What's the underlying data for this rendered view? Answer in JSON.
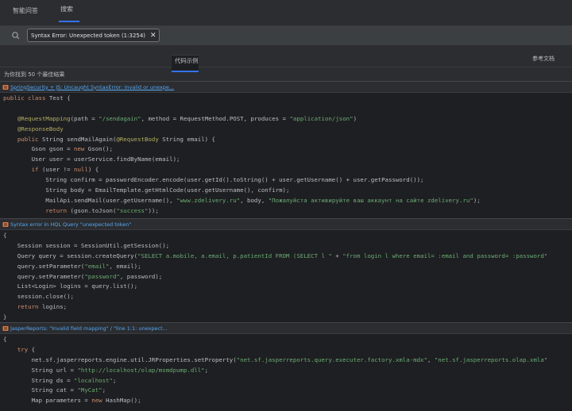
{
  "tabs": [
    {
      "label": "智能问答",
      "active": false
    },
    {
      "label": "搜索",
      "active": true
    }
  ],
  "search": {
    "query": "Syntax Error: Unexpected token (1:3254)",
    "close_glyph": "✕"
  },
  "subtabs": {
    "code_examples": "代码示例",
    "docs": "参考文档"
  },
  "result_count": "为你找到 50 个最佳结果",
  "results": [
    {
      "title": "SpringSecurity + JS: Uncaught SyntaxError: Invalid or unexpe...",
      "lines": [
        [
          {
            "t": "public class",
            "c": "kw"
          },
          {
            "t": " Test {"
          }
        ],
        [
          {
            "t": ""
          }
        ],
        [
          {
            "t": "    "
          },
          {
            "t": "@RequestMapping",
            "c": "ann"
          },
          {
            "t": "(path = "
          },
          {
            "t": "\"/sendagain\"",
            "c": "str"
          },
          {
            "t": ", method = RequestMethod.POST, produces = "
          },
          {
            "t": "\"application/json\"",
            "c": "str"
          },
          {
            "t": ")"
          }
        ],
        [
          {
            "t": "    "
          },
          {
            "t": "@ResponseBody",
            "c": "ann"
          }
        ],
        [
          {
            "t": "    "
          },
          {
            "t": "public",
            "c": "kw"
          },
          {
            "t": " String sendMailAgain("
          },
          {
            "t": "@RequestBody",
            "c": "ann"
          },
          {
            "t": " String email) {"
          }
        ],
        [
          {
            "t": "        Gson gson = "
          },
          {
            "t": "new",
            "c": "kw"
          },
          {
            "t": " Gson();"
          }
        ],
        [
          {
            "t": "        User user = userService.findByName(email);"
          }
        ],
        [
          {
            "t": "        "
          },
          {
            "t": "if",
            "c": "kw"
          },
          {
            "t": " (user != "
          },
          {
            "t": "null",
            "c": "kw"
          },
          {
            "t": ") {"
          }
        ],
        [
          {
            "t": "            String confirm = passwordEncoder.encode(user.getId().toString() + user.getUsername() + user.getPassword());"
          }
        ],
        [
          {
            "t": "            String body = EmailTemplate.getHtmlCode(user.getUsername(), confirm);"
          }
        ],
        [
          {
            "t": "            MailApi.sendMail(user.getUsername(), "
          },
          {
            "t": "\"www.zdelivery.ru\"",
            "c": "str"
          },
          {
            "t": ", body, "
          },
          {
            "t": "\"Пожалуйста активируйте ваш аккаунт на сайте zdelivery.ru\"",
            "c": "str"
          },
          {
            "t": ");"
          }
        ],
        [
          {
            "t": "            "
          },
          {
            "t": "return",
            "c": "kw"
          },
          {
            "t": " (gson.toJson("
          },
          {
            "t": "\"success\"",
            "c": "str"
          },
          {
            "t": "));"
          }
        ],
        [
          {
            "t": "        }"
          }
        ]
      ]
    },
    {
      "title": "Syntax error in HQL Query \"unexpected token\"",
      "lines": [
        [
          {
            "t": "{"
          }
        ],
        [
          {
            "t": "    Session session = SessionUtil.getSession();"
          }
        ],
        [
          {
            "t": "    Query query = session.createQuery("
          },
          {
            "t": "\"SELECT a.mobile, a.email, p.patientId FROM (SELECT l \"",
            "c": "str"
          },
          {
            "t": " + "
          },
          {
            "t": "\"from login l where email= :email and password= :password\"",
            "c": "str"
          }
        ],
        [
          {
            "t": "    query.setParameter("
          },
          {
            "t": "\"email\"",
            "c": "str"
          },
          {
            "t": ", email);"
          }
        ],
        [
          {
            "t": "    query.setParameter("
          },
          {
            "t": "\"password\"",
            "c": "str"
          },
          {
            "t": ", password);"
          }
        ],
        [
          {
            "t": "    List<Login> logins = query.list();"
          }
        ],
        [
          {
            "t": "    session.close();"
          }
        ],
        [
          {
            "t": "    "
          },
          {
            "t": "return",
            "c": "kw"
          },
          {
            "t": " logins;"
          }
        ],
        [
          {
            "t": "}"
          }
        ]
      ]
    },
    {
      "title": "JasperReports: \"Invalid field mapping\" / \"line 1:1: unexpect...",
      "lines": [
        [
          {
            "t": "{"
          }
        ],
        [
          {
            "t": "    "
          },
          {
            "t": "try",
            "c": "kw"
          },
          {
            "t": " {"
          }
        ],
        [
          {
            "t": "        net.sf.jasperreports.engine.util.JRProperties.setProperty("
          },
          {
            "t": "\"net.sf.jasperreports.query.executer.factory.xmla-mdx\"",
            "c": "str"
          },
          {
            "t": ", "
          },
          {
            "t": "\"net.sf.jasperreports.olap.xmla\"",
            "c": "str"
          }
        ],
        [
          {
            "t": "        String url = "
          },
          {
            "t": "\"http://localhost/olap/msmdpump.dll\"",
            "c": "str"
          },
          {
            "t": ";"
          }
        ],
        [
          {
            "t": "        String ds = "
          },
          {
            "t": "\"localhost\"",
            "c": "str"
          },
          {
            "t": ";"
          }
        ],
        [
          {
            "t": "        String cat = "
          },
          {
            "t": "\"MyCat\"",
            "c": "str"
          },
          {
            "t": ";"
          }
        ],
        [
          {
            "t": "        Map parameters = "
          },
          {
            "t": "new",
            "c": "kw"
          },
          {
            "t": " HashMap();"
          }
        ]
      ]
    }
  ],
  "colors": {
    "accent": "#3574f0",
    "link": "#56a8f5",
    "keyword": "#cf8e6d",
    "string": "#6aab73",
    "annotation": "#b3ae60"
  }
}
